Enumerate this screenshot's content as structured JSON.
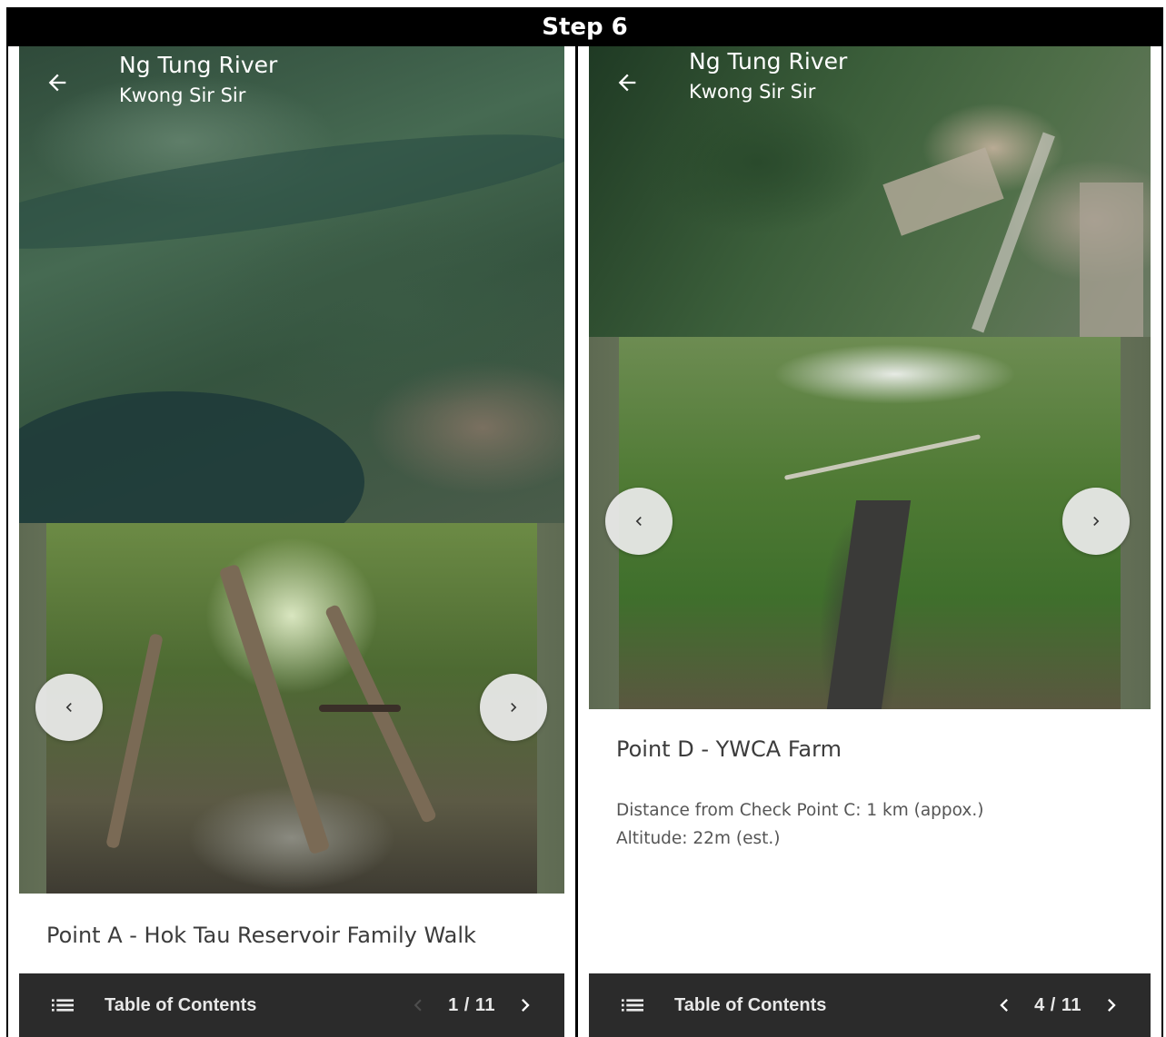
{
  "header": {
    "title": "Step 6"
  },
  "panels": [
    {
      "map": {
        "title": "Ng Tung River",
        "subtitle": "Kwong Sir Sir"
      },
      "point": {
        "title": "Point A - Hok Tau Reservoir Family Walk"
      },
      "bottom_bar": {
        "toc_label": "Table of Contents",
        "page_indicator": "1 / 11",
        "prev_enabled": false
      }
    },
    {
      "map": {
        "title": "Ng Tung River",
        "subtitle": "Kwong Sir Sir"
      },
      "point": {
        "title": "Point D - YWCA Farm",
        "distance": "Distance from Check Point C: 1 km (appox.)",
        "altitude": "Altitude: 22m (est.)"
      },
      "bottom_bar": {
        "toc_label": "Table of Contents",
        "page_indicator": "4 / 11",
        "prev_enabled": true
      }
    }
  ],
  "icons": {
    "back": "arrow-left-icon",
    "toc": "list-icon",
    "prev": "chevron-left-icon",
    "next": "chevron-right-icon"
  },
  "colors": {
    "bar": "#2b2b2b",
    "disabled_arrow": "#6e6e6e",
    "enabled_arrow": "#ffffff"
  }
}
